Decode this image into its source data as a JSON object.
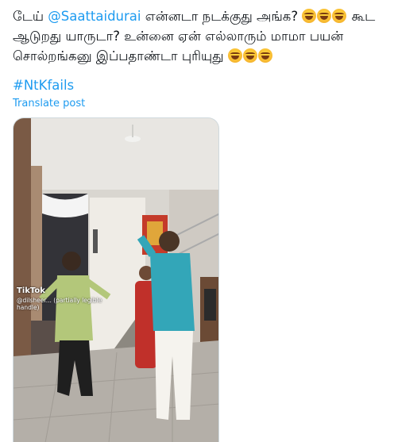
{
  "tweet": {
    "text_prefix": "டேய் ",
    "mention": "@Saattaidurai",
    "text_part1": " என்னடா நடக்குது அங்க? ",
    "text_part2": " கூட ஆடுறது யாருடா? உன்னை ஏன் எல்லாரும் மாமா பயன் சொல்றங்கனு இப்பதாண்டா புரியுது ",
    "emoji_name": "rolling-on-floor-laughing",
    "hashtag": "#NtKfails",
    "translate_label": "Translate post"
  },
  "media": {
    "watermark_logo": "TikTok",
    "watermark_user": "@dilsheer... (partially legible handle)"
  },
  "colors": {
    "link": "#1d9bf0",
    "text": "#0f1419",
    "border": "#cfd9de"
  }
}
